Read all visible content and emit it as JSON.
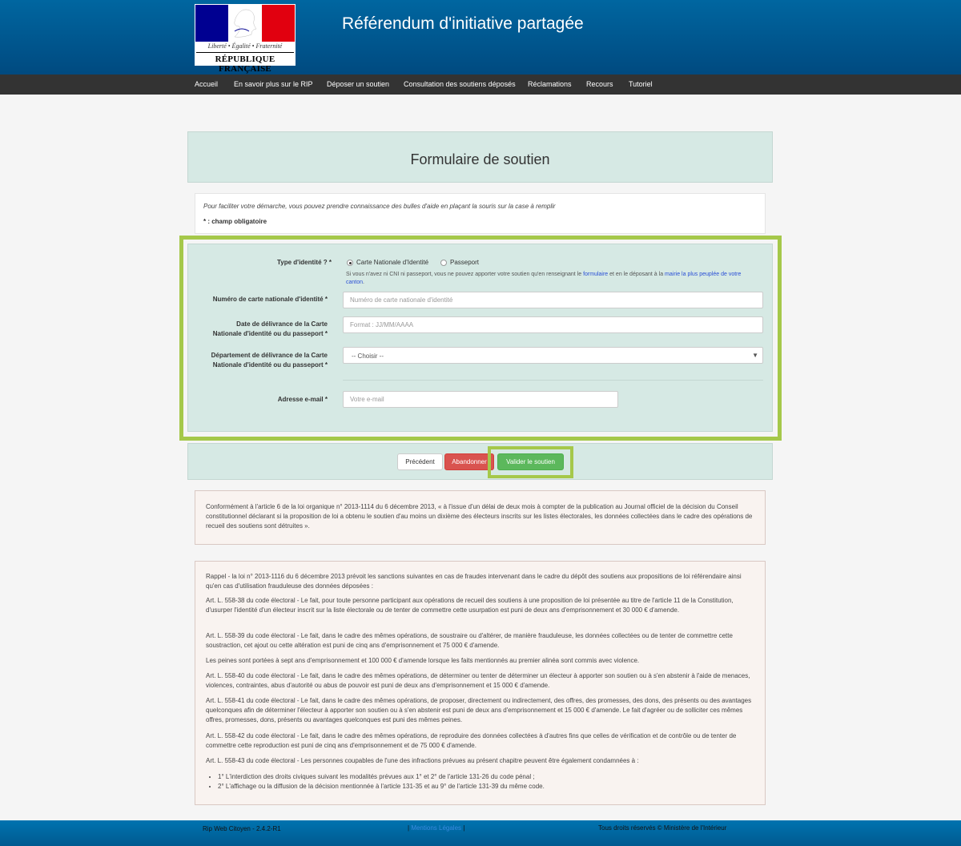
{
  "header": {
    "site_title": "Référendum d'initiative partagée",
    "logo_motto": "Liberté • Égalité • Fraternité",
    "logo_republic": "RÉPUBLIQUE FRANÇAISE"
  },
  "nav": {
    "items": [
      {
        "label": "Accueil"
      },
      {
        "label": "En savoir plus sur le RIP"
      },
      {
        "label": "Déposer un soutien"
      },
      {
        "label": "Consultation des soutiens déposés"
      },
      {
        "label": "Réclamations"
      },
      {
        "label": "Recours"
      },
      {
        "label": "Tutoriel"
      }
    ]
  },
  "page": {
    "title": "Formulaire de soutien"
  },
  "info": {
    "help": "Pour faciliter votre démarche, vous pouvez prendre connaissance des bulles d'aide en plaçant la souris sur la case à remplir",
    "required_note": "* : champ obligatoire"
  },
  "form": {
    "required_mark": "*",
    "identity_type": {
      "label": "Type d'identité ?",
      "options": [
        "Carte Nationale d'Identité",
        "Passeport"
      ],
      "selected": "Carte Nationale d'Identité",
      "help_before": "Si vous n'avez ni CNI ni passeport, vous ne pouvez apporter votre soutien qu'en renseignant le ",
      "help_link1": "formulaire",
      "help_middle": " et en le déposant à la ",
      "help_link2": "mairie la plus peuplée de votre canton",
      "help_after": "."
    },
    "card_number": {
      "label": "Numéro de carte nationale d'identité",
      "placeholder": "Numéro de carte nationale d'identité",
      "value": ""
    },
    "issue_date": {
      "label_line1": "Date de délivrance de la Carte",
      "label_line2": "Nationale d'identité ou du passeport",
      "placeholder": "Format : JJ/MM/AAAA",
      "value": ""
    },
    "department": {
      "label_line1": "Département de délivrance de la Carte",
      "label_line2": "Nationale d'identité ou du passeport",
      "selected": "-- Choisir --"
    },
    "email": {
      "label": "Adresse e-mail",
      "placeholder": "Votre e-mail",
      "value": ""
    }
  },
  "buttons": {
    "previous": "Précédent",
    "abort": "Abandonner",
    "validate": "Valider le soutien"
  },
  "legal": {
    "notice": "Conformément à l'article 6 de la loi organique n° 2013-1114 du 6 décembre 2013, « à l'issue d'un délai de deux mois à compter de la publication au Journal officiel de la décision du Conseil constitutionnel déclarant si la proposition de loi a obtenu le soutien d'au moins un dixième des électeurs inscrits sur les listes électorales, les données collectées dans le cadre des opérations de recueil des soutiens sont détruites ».",
    "paragraphs": [
      "Rappel - la loi n° 2013-1116 du 6 décembre 2013 prévoit les sanctions suivantes en cas de fraudes intervenant dans le cadre du dépôt des soutiens aux propositions de loi référendaire ainsi qu'en cas d'utilisation frauduleuse des données déposées :",
      "Art. L. 558-38 du code électoral - Le fait, pour toute personne participant aux opérations de recueil des soutiens à une proposition de loi présentée au titre de l'article 11 de la Constitution, d'usurper l'identité d'un électeur inscrit sur la liste électorale ou de tenter de commettre cette usurpation est puni de deux ans d'emprisonnement et 30 000 € d'amende.",
      "Art. L. 558-39 du code électoral - Le fait, dans le cadre des mêmes opérations, de soustraire ou d'altérer, de manière frauduleuse, les données collectées ou de tenter de commettre cette soustraction, cet ajout ou cette altération est puni de cinq ans d'emprisonnement et 75 000 € d'amende.",
      "Les peines sont portées à sept ans d'emprisonnement et 100 000 € d'amende lorsque les faits mentionnés au premier alinéa sont commis avec violence.",
      "Art. L. 558-40 du code électoral - Le fait, dans le cadre des mêmes opérations, de déterminer ou tenter de déterminer un électeur à apporter son soutien ou à s'en abstenir à l'aide de menaces, violences, contraintes, abus d'autorité ou abus de pouvoir est puni de deux ans d'emprisonnement et 15 000 € d'amende.",
      "Art. L. 558-41 du code électoral - Le fait, dans le cadre des mêmes opérations, de proposer, directement ou indirectement, des offres, des promesses, des dons, des présents ou des avantages quelconques afin de déterminer l'électeur à apporter son soutien ou à s'en abstenir est puni de deux ans d'emprisonnement et 15 000 € d'amende. Le fait d'agréer ou de solliciter ces mêmes offres, promesses, dons, présents ou avantages quelconques est puni des mêmes peines.",
      "Art. L. 558-42 du code électoral - Le fait, dans le cadre des mêmes opérations, de reproduire des données collectées à d'autres fins que celles de vérification et de contrôle ou de tenter de commettre cette reproduction est puni de cinq ans d'emprisonnement et de 75 000 € d'amende.",
      "Art. L. 558-43 du code électoral - Les personnes coupables de l'une des infractions prévues au présent chapitre peuvent être également condamnées à :"
    ],
    "list": [
      "1° L'interdiction des droits civiques suivant les modalités prévues aux 1° et 2° de l'article 131-26 du code pénal ;",
      "2° L'affichage ou la diffusion de la décision mentionnée à l'article 131-35 et au 9° de l'article 131-39 du même code."
    ]
  },
  "footer": {
    "version": "Rip Web Citoyen - 2.4.2-R1",
    "sep_left": "| ",
    "legal_link": "Mentions Légales",
    "sep_right": " |",
    "rights": "Tous droits réservés © Ministère de l'Intérieur"
  }
}
